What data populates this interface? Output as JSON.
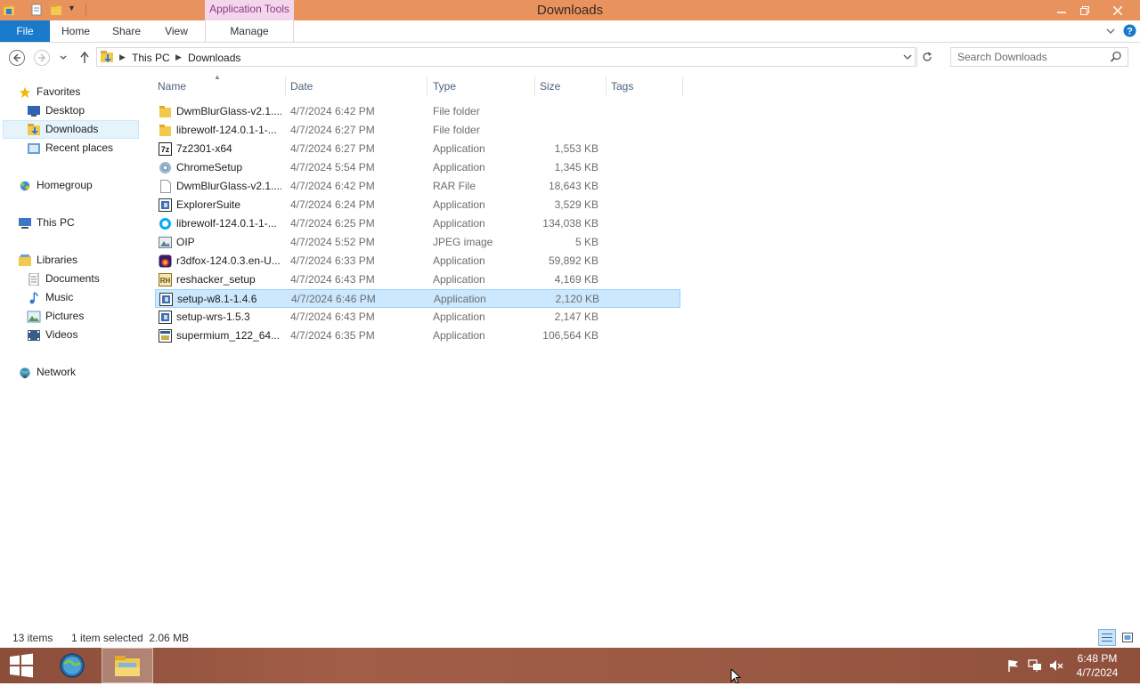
{
  "window": {
    "title": "Downloads",
    "context_tab": "Application Tools"
  },
  "ribbon": {
    "tabs": [
      "File",
      "Home",
      "Share",
      "View",
      "Manage"
    ]
  },
  "address": {
    "crumbs": [
      "This PC",
      "Downloads"
    ]
  },
  "search": {
    "placeholder": "Search Downloads"
  },
  "nav": {
    "favorites": "Favorites",
    "fav_items": [
      "Desktop",
      "Downloads",
      "Recent places"
    ],
    "homegroup": "Homegroup",
    "thispc": "This PC",
    "libraries": "Libraries",
    "lib_items": [
      "Documents",
      "Music",
      "Pictures",
      "Videos"
    ],
    "network": "Network"
  },
  "columns": {
    "name": "Name",
    "date": "Date",
    "type": "Type",
    "size": "Size",
    "tags": "Tags"
  },
  "files": [
    {
      "name": "DwmBlurGlass-v2.1....",
      "date": "4/7/2024 6:42 PM",
      "type": "File folder",
      "size": "",
      "icon": "folder-icon"
    },
    {
      "name": "librewolf-124.0.1-1-...",
      "date": "4/7/2024 6:27 PM",
      "type": "File folder",
      "size": "",
      "icon": "folder-icon"
    },
    {
      "name": "7z2301-x64",
      "date": "4/7/2024 6:27 PM",
      "type": "Application",
      "size": "1,553 KB",
      "icon": "7zip-icon"
    },
    {
      "name": "ChromeSetup",
      "date": "4/7/2024 5:54 PM",
      "type": "Application",
      "size": "1,345 KB",
      "icon": "chrome-setup-icon"
    },
    {
      "name": "DwmBlurGlass-v2.1....",
      "date": "4/7/2024 6:42 PM",
      "type": "RAR File",
      "size": "18,643 KB",
      "icon": "file-icon"
    },
    {
      "name": "ExplorerSuite",
      "date": "4/7/2024 6:24 PM",
      "type": "Application",
      "size": "3,529 KB",
      "icon": "installer-icon"
    },
    {
      "name": "librewolf-124.0.1-1-...",
      "date": "4/7/2024 6:25 PM",
      "type": "Application",
      "size": "134,038 KB",
      "icon": "librewolf-icon"
    },
    {
      "name": "OIP",
      "date": "4/7/2024 5:52 PM",
      "type": "JPEG image",
      "size": "5 KB",
      "icon": "image-icon"
    },
    {
      "name": "r3dfox-124.0.3.en-U...",
      "date": "4/7/2024 6:33 PM",
      "type": "Application",
      "size": "59,892 KB",
      "icon": "r3dfox-icon"
    },
    {
      "name": "reshacker_setup",
      "date": "4/7/2024 6:43 PM",
      "type": "Application",
      "size": "4,169 KB",
      "icon": "reshacker-icon"
    },
    {
      "name": "setup-w8.1-1.4.6",
      "date": "4/7/2024 6:46 PM",
      "type": "Application",
      "size": "2,120 KB",
      "icon": "installer-icon"
    },
    {
      "name": "setup-wrs-1.5.3",
      "date": "4/7/2024 6:43 PM",
      "type": "Application",
      "size": "2,147 KB",
      "icon": "installer-icon"
    },
    {
      "name": "supermium_122_64...",
      "date": "4/7/2024 6:35 PM",
      "type": "Application",
      "size": "106,564 KB",
      "icon": "app-icon"
    }
  ],
  "selected_index": 10,
  "status": {
    "count": "13 items",
    "selection": "1 item selected  2.06 MB"
  },
  "clock": {
    "time": "6:48 PM",
    "date": "4/7/2024"
  },
  "colors": {
    "titlebar": "#e8925e",
    "file_tab": "#1979ca",
    "selection": "#cce8ff",
    "taskbar": "#9b5a44"
  }
}
